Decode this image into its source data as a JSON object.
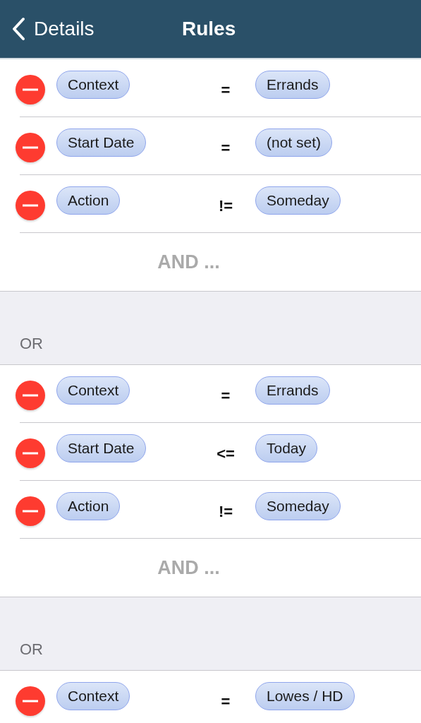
{
  "nav": {
    "back_label": "Details",
    "title": "Rules"
  },
  "groups": [
    {
      "conditions": [
        {
          "field": "Context",
          "operator": "=",
          "value": "Errands"
        },
        {
          "field": "Start Date",
          "operator": "=",
          "value": "(not set)"
        },
        {
          "field": "Action",
          "operator": "!=",
          "value": "Someday"
        }
      ],
      "add_label": "AND ..."
    },
    {
      "header": "OR",
      "conditions": [
        {
          "field": "Context",
          "operator": "=",
          "value": "Errands"
        },
        {
          "field": "Start Date",
          "operator": "<=",
          "value": "Today"
        },
        {
          "field": "Action",
          "operator": "!=",
          "value": "Someday"
        }
      ],
      "add_label": "AND ..."
    },
    {
      "header": "OR",
      "conditions": [
        {
          "field": "Context",
          "operator": "=",
          "value": "Lowes / HD"
        }
      ]
    }
  ]
}
